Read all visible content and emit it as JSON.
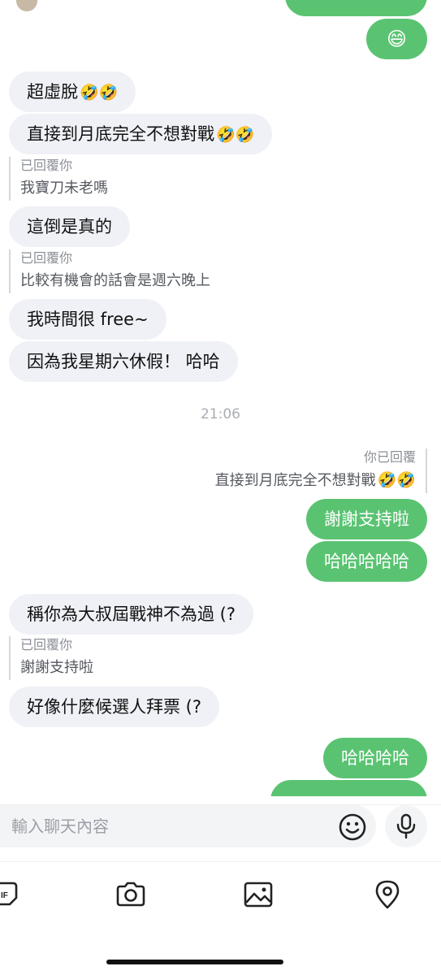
{
  "messages": {
    "m0_emoji": "😄",
    "m1": {
      "text": "超虛脫",
      "emoji": "🤣🤣"
    },
    "m2": {
      "text": "直接到月底完全不想對戰",
      "emoji": "🤣🤣"
    },
    "r1": {
      "who": "已回覆你",
      "quote": "我寶刀未老嗎"
    },
    "m3": {
      "text": "這倒是真的"
    },
    "r2": {
      "who": "已回覆你",
      "quote": "比較有機會的話會是週六晚上"
    },
    "m4": {
      "text": "我時間很 free~"
    },
    "m5": {
      "text": "因為我星期六休假！ 哈哈"
    },
    "time": "21:06",
    "r3": {
      "who": "你已回覆",
      "quote": "直接到月底完全不想對戰",
      "emoji": "🤣🤣"
    },
    "o1": {
      "text": "謝謝支持啦"
    },
    "o2": {
      "text": "哈哈哈哈哈"
    },
    "m6": {
      "text": "稱你為大叔屆戰神不為過 (?"
    },
    "r4": {
      "who": "已回覆你",
      "quote": "謝謝支持啦"
    },
    "m7": {
      "text": "好像什麼候選人拜票 (?"
    },
    "o3": {
      "text": "哈哈哈哈"
    }
  },
  "composer": {
    "placeholder": "輸入聊天內容"
  },
  "toolbar": {
    "icons": [
      "gif-icon",
      "camera-icon",
      "image-icon",
      "location-icon"
    ]
  },
  "colors": {
    "outgoing": "#5ac372",
    "incoming": "#eff1f6"
  }
}
